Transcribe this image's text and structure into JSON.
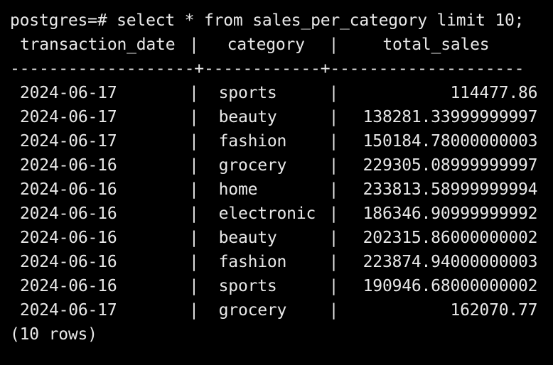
{
  "terminal": {
    "prompt": "postgres=#",
    "command": "select * from sales_per_category limit 10;",
    "columns": [
      "transaction_date",
      "category",
      "total_sales"
    ],
    "separator": "-------------------+------------+--------------------",
    "rows": [
      {
        "transaction_date": "2024-06-17",
        "category": "sports",
        "total_sales": "114477.86"
      },
      {
        "transaction_date": "2024-06-17",
        "category": "beauty",
        "total_sales": "138281.33999999997"
      },
      {
        "transaction_date": "2024-06-17",
        "category": "fashion",
        "total_sales": "150184.78000000003"
      },
      {
        "transaction_date": "2024-06-16",
        "category": "grocery",
        "total_sales": "229305.08999999997"
      },
      {
        "transaction_date": "2024-06-16",
        "category": "home",
        "total_sales": "233813.58999999994"
      },
      {
        "transaction_date": "2024-06-16",
        "category": "electronic",
        "total_sales": "186346.90999999992"
      },
      {
        "transaction_date": "2024-06-16",
        "category": "beauty",
        "total_sales": "202315.86000000002"
      },
      {
        "transaction_date": "2024-06-16",
        "category": "fashion",
        "total_sales": "223874.94000000003"
      },
      {
        "transaction_date": "2024-06-16",
        "category": "sports",
        "total_sales": "190946.68000000002"
      },
      {
        "transaction_date": "2024-06-17",
        "category": "grocery",
        "total_sales": "162070.77"
      }
    ],
    "row_count": "(10 rows)",
    "colors": {
      "background": "#000000",
      "text": "#e8e8e8"
    }
  }
}
